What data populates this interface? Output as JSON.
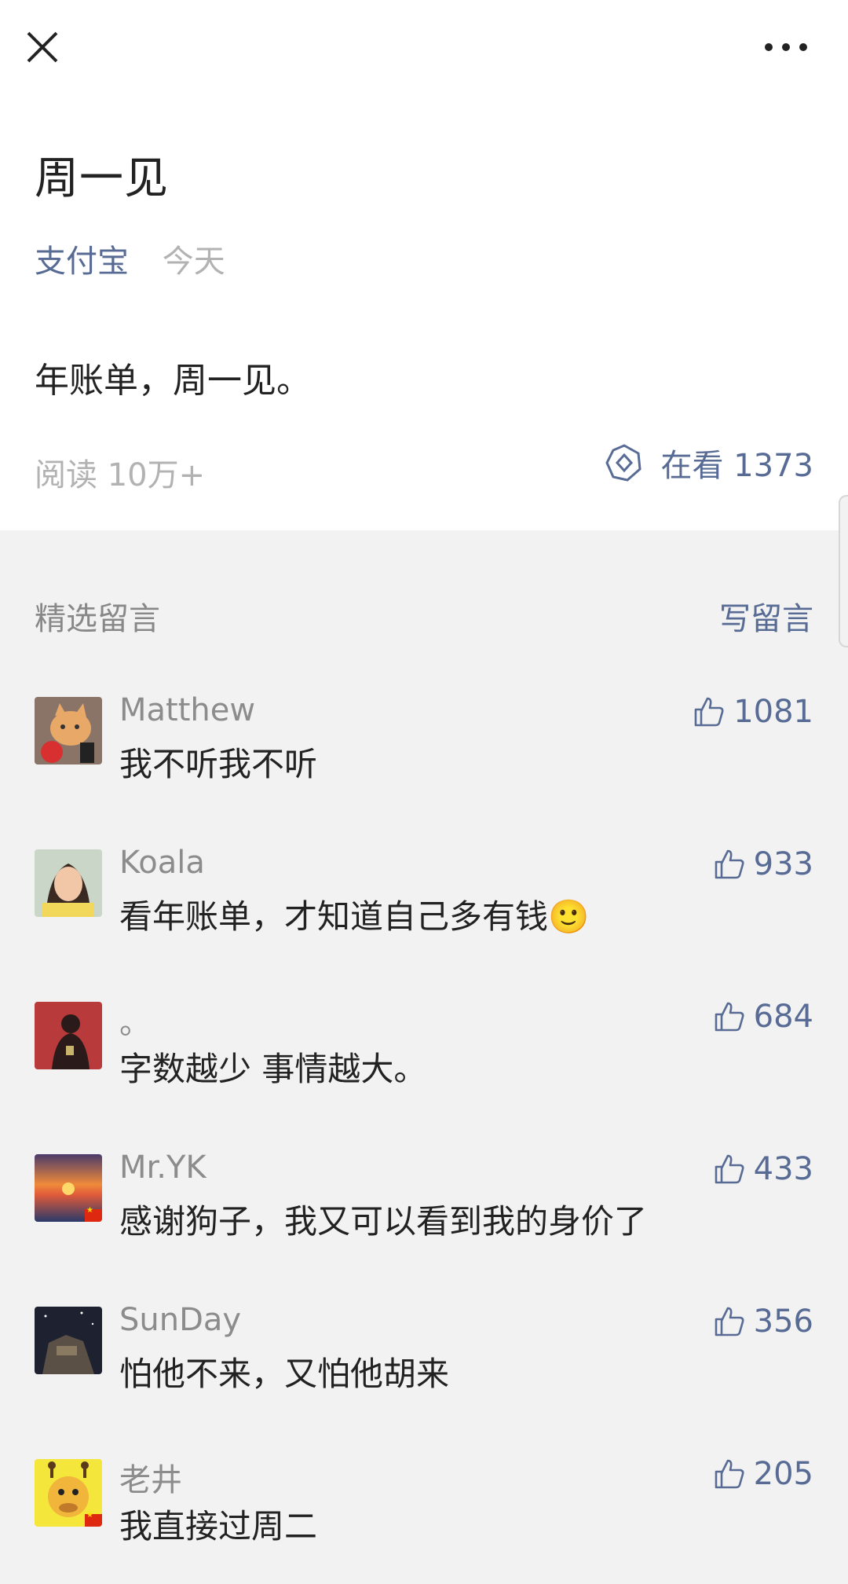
{
  "topbar": {
    "close_icon": "close-icon",
    "more_icon": "more-icon"
  },
  "article": {
    "title": "周一见",
    "author": "支付宝",
    "date": "今天",
    "body": "年账单，周一见。",
    "reads": "阅读 10万+",
    "watching_label": "在看 1373"
  },
  "comments": {
    "section_title": "精选留言",
    "write_label": "写留言",
    "items": [
      {
        "name": "Matthew",
        "text": "我不听我不听",
        "likes": "1081"
      },
      {
        "name": "Koala",
        "text": "看年账单，才知道自己多有钱🙂",
        "likes": "933"
      },
      {
        "name": "。",
        "text": "字数越少 事情越大。",
        "likes": "684"
      },
      {
        "name": "Mr.YK",
        "text": "感谢狗子，我又可以看到我的身价了",
        "likes": "433"
      },
      {
        "name": "SunDay",
        "text": "怕他不来，又怕他胡来",
        "likes": "356"
      },
      {
        "name": "老井",
        "text": "我直接过周二",
        "likes": "205"
      }
    ]
  },
  "colors": {
    "link": "#576b95",
    "muted": "#b2b2b2",
    "background": "#f2f2f2"
  }
}
